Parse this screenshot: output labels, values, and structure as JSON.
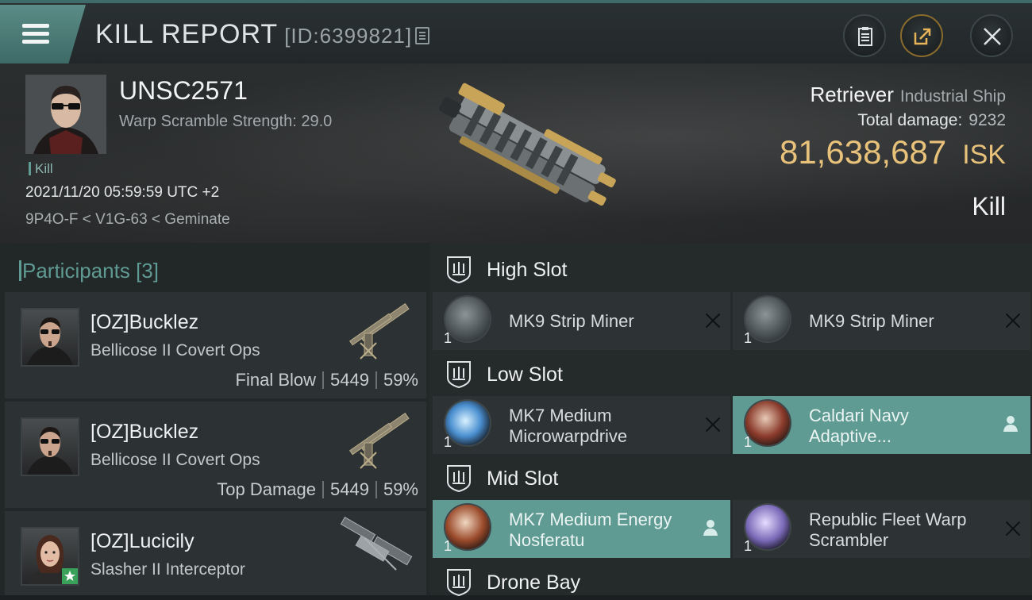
{
  "header": {
    "title": "KILL REPORT",
    "report_id": "[ID:6399821]"
  },
  "victim": {
    "name": "UNSC2571",
    "warp_scramble": "Warp Scramble Strength: 29.0",
    "tag": "Kill",
    "datetime": "2021/11/20 05:59:59 UTC +2",
    "location": "9P4O-F < V1G-63 < Geminate",
    "ship_name": "Retriever",
    "ship_class": "Industrial Ship",
    "damage_label": "Total damage:",
    "damage_value": "9232",
    "isk_value": "81,638,687",
    "isk_unit": "ISK",
    "result": "Kill"
  },
  "participants": {
    "label": "Participants",
    "count": "[3]",
    "list": [
      {
        "name": "[OZ]Bucklez",
        "ship": "Bellicose II Covert Ops",
        "role": "Final Blow",
        "damage": "5449",
        "percent": "59%"
      },
      {
        "name": "[OZ]Bucklez",
        "ship": "Bellicose II Covert Ops",
        "role": "Top Damage",
        "damage": "5449",
        "percent": "59%"
      },
      {
        "name": "[OZ]Lucicily",
        "ship": "Slasher II Interceptor"
      }
    ]
  },
  "slots": {
    "high": {
      "label": "High Slot",
      "items": [
        {
          "qty": "1",
          "line1": "MK9 Strip Miner",
          "line2": ""
        },
        {
          "qty": "1",
          "line1": "MK9 Strip Miner",
          "line2": ""
        }
      ]
    },
    "low": {
      "label": "Low Slot",
      "items": [
        {
          "qty": "1",
          "line1": "MK7 Medium",
          "line2": "Microwarpdrive"
        },
        {
          "qty": "1",
          "line1": "Caldari Navy",
          "line2": "Adaptive..."
        }
      ]
    },
    "mid": {
      "label": "Mid Slot",
      "items": [
        {
          "qty": "1",
          "line1": "MK7 Medium Energy",
          "line2": "Nosferatu"
        },
        {
          "qty": "1",
          "line1": "Republic Fleet Warp",
          "line2": "Scrambler"
        }
      ]
    },
    "drone": {
      "label": "Drone Bay"
    }
  },
  "colors": {
    "accent": "#5f9b93",
    "isk": "#e8c27a",
    "panel": "#2d3234"
  }
}
